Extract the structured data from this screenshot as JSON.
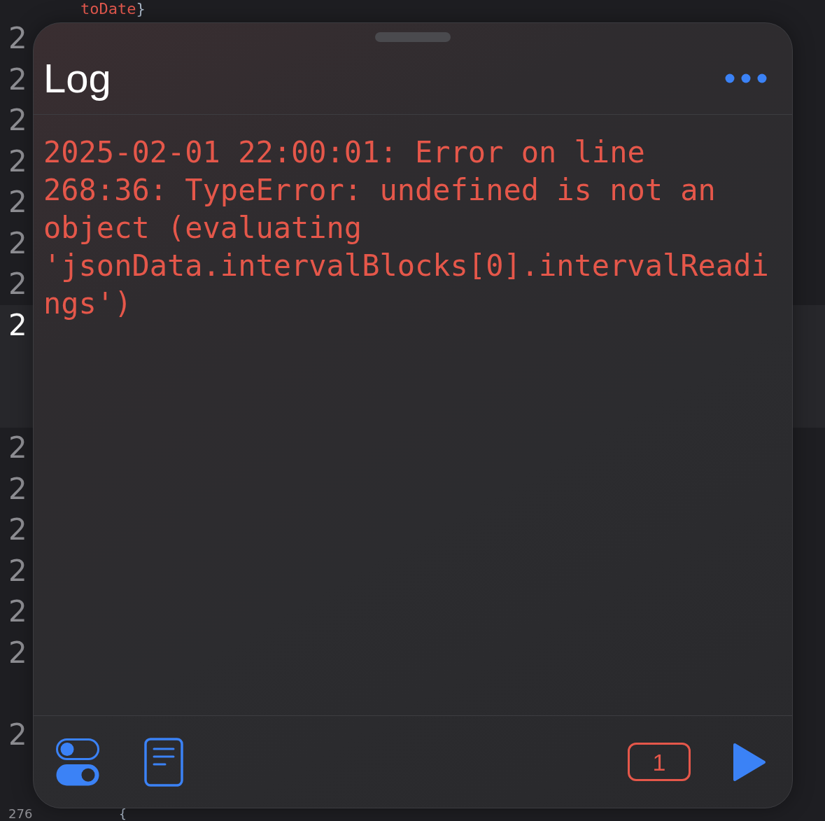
{
  "editor": {
    "lines": [
      {
        "code": [
          {
            "kind": "string",
            "text": "toDate"
          },
          {
            "kind": "punctuation",
            "text": "}"
          }
        ]
      },
      {
        "number": "2",
        "current": false
      },
      {
        "number": "2",
        "current": false
      },
      {
        "number": "2",
        "current": false
      },
      {
        "number": "2",
        "current": false
      },
      {
        "number": "2",
        "current": false
      },
      {
        "number": "2",
        "current": false
      },
      {
        "number": "2",
        "current": false
      },
      {
        "number": "2",
        "current": true
      },
      {
        "number": "2",
        "current": false
      },
      {
        "number": "2",
        "current": false
      },
      {
        "number": "2",
        "current": false
      },
      {
        "number": "2",
        "current": false
      },
      {
        "number": "2",
        "current": false
      },
      {
        "number": "2",
        "current": false
      },
      {
        "number": "2",
        "current": false
      },
      {
        "number": "276",
        "current": false,
        "code": [
          {
            "kind": "punctuation",
            "text": "{"
          }
        ]
      }
    ]
  },
  "log_panel": {
    "title": "Log",
    "entries": [
      {
        "kind": "error",
        "text": "2025-02-01 22:00:01: Error on line 268:36: TypeError: undefined is not an object (evaluating 'jsonData.intervalBlocks[0].intervalReadings')"
      }
    ],
    "error_count": "1"
  }
}
